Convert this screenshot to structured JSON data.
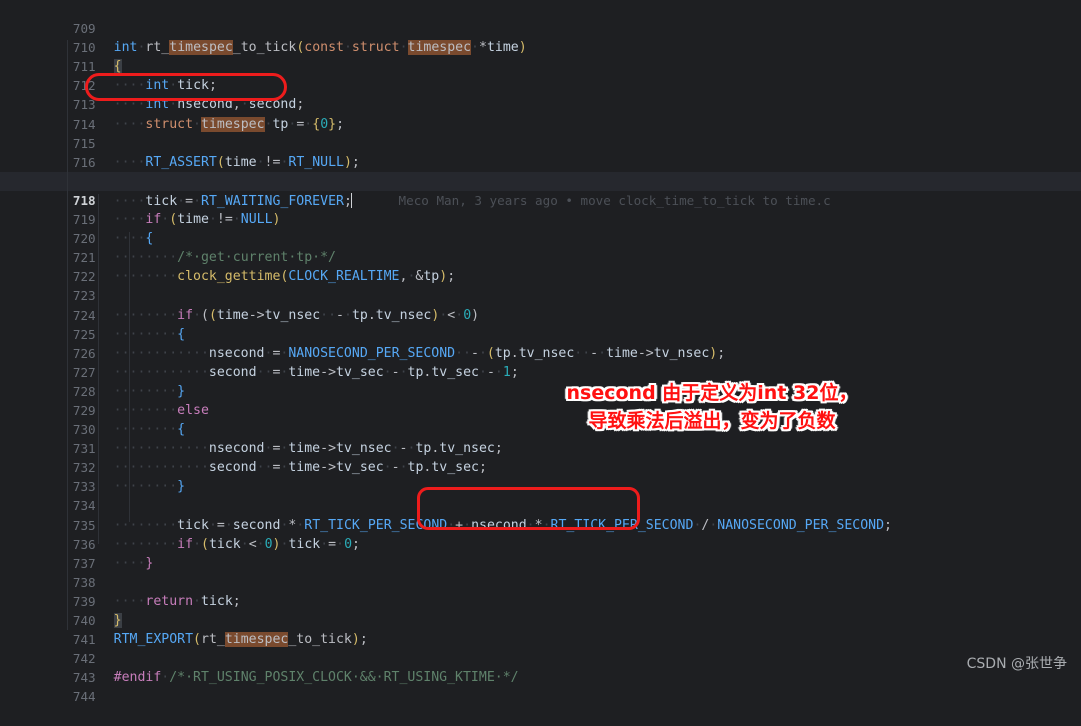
{
  "editor": {
    "theme": "dark",
    "background": "#1e1f22",
    "first_line": 709,
    "last_line": 744,
    "current_line": 718,
    "blame": "Meco Man, 3 years ago • move clock_time_to_tick to time.c",
    "lines": [
      {
        "n": "709",
        "code": ""
      },
      {
        "n": "710",
        "code": "int rt_timespec_to_tick(const struct timespec *time)"
      },
      {
        "n": "711",
        "code": "{"
      },
      {
        "n": "712",
        "code": "    int tick;"
      },
      {
        "n": "713",
        "code": "    int nsecond, second;"
      },
      {
        "n": "714",
        "code": "    struct timespec tp = {0};"
      },
      {
        "n": "715",
        "code": ""
      },
      {
        "n": "716",
        "code": "    RT_ASSERT(time != RT_NULL);"
      },
      {
        "n": "717",
        "code": ""
      },
      {
        "n": "718",
        "code": "    tick = RT_WAITING_FOREVER;"
      },
      {
        "n": "719",
        "code": "    if (time != NULL)"
      },
      {
        "n": "720",
        "code": "    {"
      },
      {
        "n": "721",
        "code": "        /* get current tp */"
      },
      {
        "n": "722",
        "code": "        clock_gettime(CLOCK_REALTIME, &tp);"
      },
      {
        "n": "723",
        "code": ""
      },
      {
        "n": "724",
        "code": "        if ((time->tv_nsec - tp.tv_nsec) < 0)"
      },
      {
        "n": "725",
        "code": "        {"
      },
      {
        "n": "726",
        "code": "            nsecond = NANOSECOND_PER_SECOND - (tp.tv_nsec - time->tv_nsec);"
      },
      {
        "n": "727",
        "code": "            second  = time->tv_sec - tp.tv_sec - 1;"
      },
      {
        "n": "728",
        "code": "        }"
      },
      {
        "n": "729",
        "code": "        else"
      },
      {
        "n": "730",
        "code": "        {"
      },
      {
        "n": "731",
        "code": "            nsecond = time->tv_nsec - tp.tv_nsec;"
      },
      {
        "n": "732",
        "code": "            second  = time->tv_sec - tp.tv_sec;"
      },
      {
        "n": "733",
        "code": "        }"
      },
      {
        "n": "734",
        "code": ""
      },
      {
        "n": "735",
        "code": "        tick = second * RT_TICK_PER_SECOND + nsecond * RT_TICK_PER_SECOND / NANOSECOND_PER_SECOND;"
      },
      {
        "n": "736",
        "code": "        if (tick < 0) tick = 0;"
      },
      {
        "n": "737",
        "code": "    }"
      },
      {
        "n": "738",
        "code": ""
      },
      {
        "n": "739",
        "code": "    return tick;"
      },
      {
        "n": "740",
        "code": "}"
      },
      {
        "n": "741",
        "code": "RTM_EXPORT(rt_timespec_to_tick);"
      },
      {
        "n": "742",
        "code": ""
      },
      {
        "n": "743",
        "code": "#endif /* RT_USING_POSIX_CLOCK && RT_USING_KTIME */"
      },
      {
        "n": "744",
        "code": ""
      }
    ]
  },
  "annotations": {
    "note_text": "nsecond 由于定义为int 32位，\n导致乘法后溢出，变为了负数",
    "note_color": "#ff1111",
    "box_color": "#ee1c1c",
    "box1_target": "int nsecond, second;",
    "box2_target": "nsecond * RT_TICK_PER_SECOND"
  },
  "watermark": {
    "text": "CSDN @张世争"
  }
}
